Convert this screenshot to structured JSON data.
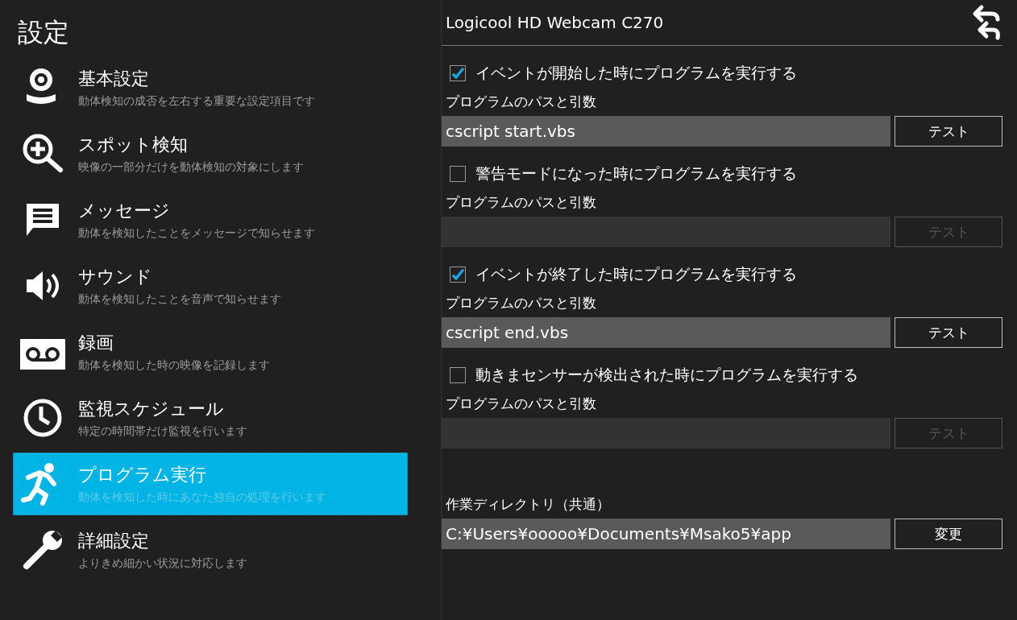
{
  "sidebar": {
    "title": "設定",
    "items": [
      {
        "title": "基本設定",
        "description": "動体検知の成否を左右する重要な設定項目です",
        "selected": false
      },
      {
        "title": "スポット検知",
        "description": "映像の一部分だけを動体検知の対象にします",
        "selected": false
      },
      {
        "title": "メッセージ",
        "description": "動体を検知したことをメッセージで知らせます",
        "selected": false
      },
      {
        "title": "サウンド",
        "description": "動体を検知したことを音声で知らせます",
        "selected": false
      },
      {
        "title": "録画",
        "description": "動体を検知した時の映像を記録します",
        "selected": false
      },
      {
        "title": "監視スケジュール",
        "description": "特定の時間帯だけ監視を行います",
        "selected": false
      },
      {
        "title": "プログラム実行",
        "description": "動体を検知した時にあなた独自の処理を行います",
        "selected": true
      },
      {
        "title": "詳細設定",
        "description": "よりきめ細かい状況に対応します",
        "selected": false
      }
    ]
  },
  "device": {
    "title": "Logicool HD Webcam C270"
  },
  "triggers": [
    {
      "label": "イベントが開始した時にプログラムを実行する",
      "checked": true,
      "path_label": "プログラムのパスと引数",
      "path_value": "cscript start.vbs",
      "test_button": "テスト"
    },
    {
      "label": "警告モードになった時にプログラムを実行する",
      "checked": false,
      "path_label": "プログラムのパスと引数",
      "test_button": "テスト"
    },
    {
      "label": "イベントが終了した時にプログラムを実行する",
      "checked": true,
      "path_label": "プログラムのパスと引数",
      "path_value": "cscript end.vbs",
      "test_button": "テスト"
    },
    {
      "label": "動きまセンサーが検出された時にプログラムを実行する",
      "checked": false,
      "path_label": "プログラムのパスと引数",
      "test_button": "テスト"
    }
  ],
  "working_directory": {
    "label": "作業ディレクトリ（共通）",
    "value": "C:¥Users¥ooooo¥Documents¥Msako5¥app",
    "button": "変更"
  }
}
